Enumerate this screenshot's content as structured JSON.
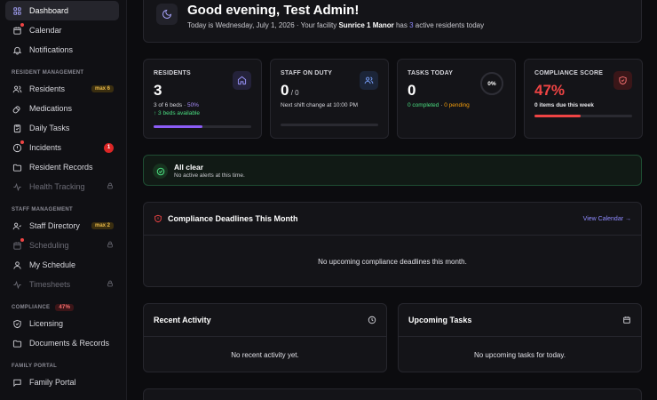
{
  "sidebar": {
    "top": [
      {
        "label": "Dashboard",
        "icon": "dashboard-icon",
        "active": true
      },
      {
        "label": "Calendar",
        "icon": "calendar-icon",
        "dot": true
      },
      {
        "label": "Notifications",
        "icon": "bell-icon"
      }
    ],
    "resident_section": "RESIDENT MANAGEMENT",
    "resident_items": [
      {
        "label": "Residents",
        "icon": "users-icon",
        "badge": "max 6"
      },
      {
        "label": "Medications",
        "icon": "pill-icon"
      },
      {
        "label": "Daily Tasks",
        "icon": "clipboard-icon"
      },
      {
        "label": "Incidents",
        "icon": "alert-icon",
        "dot": true,
        "count": "1"
      },
      {
        "label": "Resident Records",
        "icon": "folder-icon"
      },
      {
        "label": "Health Tracking",
        "icon": "activity-icon",
        "locked": true
      }
    ],
    "staff_section": "STAFF MANAGEMENT",
    "staff_items": [
      {
        "label": "Staff Directory",
        "icon": "user-group-icon",
        "badge": "max 2"
      },
      {
        "label": "Scheduling",
        "icon": "calendar-icon",
        "locked": true,
        "dot": true
      },
      {
        "label": "My Schedule",
        "icon": "user-icon"
      },
      {
        "label": "Timesheets",
        "icon": "activity-icon",
        "locked": true
      }
    ],
    "compliance_section": "COMPLIANCE",
    "compliance_badge": "47%",
    "compliance_items": [
      {
        "label": "Licensing",
        "icon": "shield-icon"
      },
      {
        "label": "Documents & Records",
        "icon": "folder-icon"
      }
    ],
    "family_section": "FAMILY PORTAL",
    "family_items": [
      {
        "label": "Family Portal",
        "icon": "chat-icon"
      }
    ]
  },
  "welcome": {
    "title": "Good evening, Test Admin!",
    "prefix": "Today is Wednesday, July 1, 2026 · Your facility ",
    "facility": "Sunrice 1 Manor",
    "mid": " has ",
    "count": "3",
    "suffix": " active residents today"
  },
  "stats": {
    "residents": {
      "title": "RESIDENTS",
      "value": "3",
      "sub_a": "3 of 6 beds · ",
      "sub_b": "50%",
      "sub_c": "↑ 3 beds available",
      "progress": 0.5,
      "color": "#8b5cf6"
    },
    "staff": {
      "title": "STAFF ON DUTY",
      "value": "0",
      "of": " / 0",
      "sub": "Next shift change at 10:00 PM",
      "progress": 0
    },
    "tasks": {
      "title": "TASKS TODAY",
      "value": "0",
      "sub_a": "0 completed",
      "sub_sep": " · ",
      "sub_b": "0 pending",
      "ring": "0%"
    },
    "compliance": {
      "title": "COMPLIANCE SCORE",
      "value": "47%",
      "sub": "0 items due this week",
      "progress": 0.47,
      "color": "#ef4444"
    }
  },
  "alert": {
    "title": "All clear",
    "text": "No active alerts at this time."
  },
  "deadlines": {
    "title": "Compliance Deadlines This Month",
    "link": "View Calendar →",
    "empty": "No upcoming compliance deadlines this month."
  },
  "activity": {
    "title": "Recent Activity",
    "empty": "No recent activity yet."
  },
  "upcoming": {
    "title": "Upcoming Tasks",
    "empty": "No upcoming tasks for today."
  }
}
